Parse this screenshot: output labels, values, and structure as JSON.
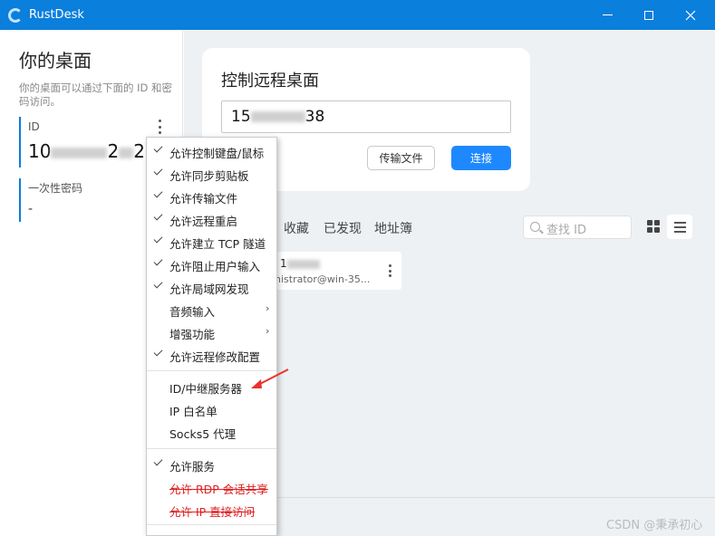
{
  "window": {
    "title": "RustDesk",
    "accent": "#0a7fdc"
  },
  "left": {
    "heading": "你的桌面",
    "desc": "你的桌面可以通过下面的 ID 和密码访问。",
    "id_label": "ID",
    "id_value_start": "10",
    "id_value_end": "2",
    "id_value_mid": "2",
    "pw_label": "一次性密码",
    "pw_value": "-"
  },
  "card": {
    "title": "控制远程桌面",
    "input_start": "15",
    "input_end": "38",
    "file_btn": "传输文件",
    "connect_btn": "连接"
  },
  "tabs": [
    "收藏",
    "已发现",
    "地址簿"
  ],
  "search": {
    "placeholder": "查找 ID"
  },
  "peer": {
    "id_start": "1",
    "name": "nistrator@win-35..."
  },
  "menu": {
    "items": [
      {
        "label": "允许控制键盘/鼠标",
        "checked": true
      },
      {
        "label": "允许同步剪贴板",
        "checked": true
      },
      {
        "label": "允许传输文件",
        "checked": true
      },
      {
        "label": "允许远程重启",
        "checked": true
      },
      {
        "label": "允许建立 TCP 隧道",
        "checked": true
      },
      {
        "label": "允许阻止用户输入",
        "checked": true
      },
      {
        "label": "允许局域网发现",
        "checked": true
      },
      {
        "label": "音频输入",
        "submenu": true
      },
      {
        "label": "增强功能",
        "submenu": true
      },
      {
        "label": "允许远程修改配置",
        "checked": true
      }
    ],
    "server_items": [
      "ID/中继服务器",
      "IP 白名单",
      "Socks5 代理"
    ],
    "service_item": "允许服务",
    "disabled_items": [
      "允许 RDP 会话共享",
      "允许 IP 直接访问"
    ]
  },
  "watermark": "CSDN @秉承初心"
}
